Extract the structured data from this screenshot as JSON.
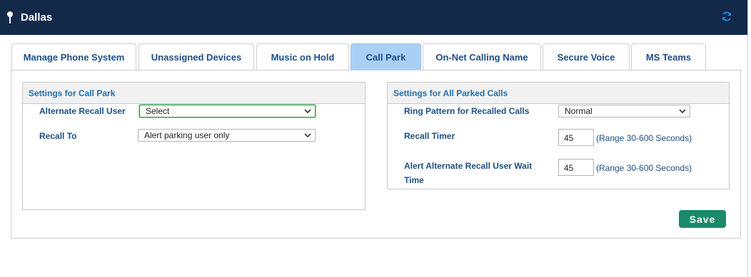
{
  "header": {
    "title": "Dallas"
  },
  "tabs": [
    {
      "label": "Manage Phone System",
      "active": false
    },
    {
      "label": "Unassigned Devices",
      "active": false
    },
    {
      "label": "Music on Hold",
      "active": false
    },
    {
      "label": "Call Park",
      "active": true
    },
    {
      "label": "On-Net Calling Name",
      "active": false
    },
    {
      "label": "Secure Voice",
      "active": false
    },
    {
      "label": "MS Teams",
      "active": false
    }
  ],
  "call_park": {
    "heading": "Settings for Call Park",
    "alternate_recall_user_label": "Alternate Recall User",
    "alternate_recall_user_value": "Select",
    "recall_to_label": "Recall To",
    "recall_to_value": "Alert parking user only"
  },
  "parked_calls": {
    "heading": "Settings for All Parked Calls",
    "ring_pattern_label": "Ring Pattern for Recalled Calls",
    "ring_pattern_value": "Normal",
    "recall_timer_label": "Recall Timer",
    "recall_timer_value": "45",
    "recall_timer_hint": "(Range 30-600 Seconds)",
    "alert_wait_label_line1": "Alert Alternate Recall User Wait",
    "alert_wait_label_line2": "Time",
    "alert_wait_value": "45",
    "alert_wait_hint": "(Range 30-600 Seconds)"
  },
  "actions": {
    "save_label": "Save"
  },
  "colors": {
    "header_bg": "#12294a",
    "active_tab": "#a9cff5",
    "label_text": "#1d4f86",
    "section_heading": "#1d6fb0",
    "save_button": "#1a8a6a"
  },
  "icons": {
    "location": "pin-icon",
    "refresh": "refresh-icon",
    "dropdown": "chevron-down-icon"
  }
}
